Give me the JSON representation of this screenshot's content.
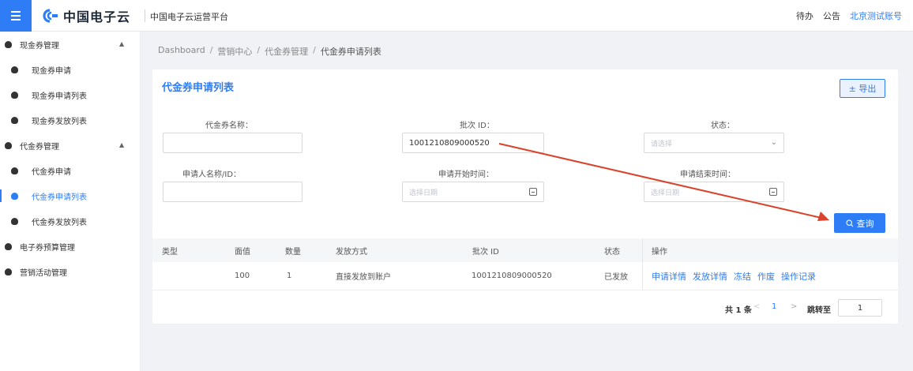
{
  "header": {
    "logo_text": "中国电子云",
    "platform_name": "中国电子云运营平台",
    "todo_label": "待办",
    "notice_label": "公告",
    "account_label": "北京测试账号"
  },
  "sidebar": {
    "groups": [
      {
        "label": "现金券管理",
        "items": [
          "现金券申请",
          "现金券申请列表",
          "现金券发放列表"
        ]
      },
      {
        "label": "代金券管理",
        "items": [
          "代金券申请",
          "代金券申请列表",
          "代金券发放列表"
        ]
      },
      {
        "label": "电子券预算管理"
      },
      {
        "label": "营销活动管理"
      }
    ],
    "active_item": "代金券申请列表"
  },
  "breadcrumb": [
    "Dashboard",
    "营销中心",
    "代金券管理",
    "代金券申请列表"
  ],
  "breadcrumb_separator": "/",
  "card": {
    "title": "代金券申请列表",
    "export_label": "± 导出"
  },
  "filters": {
    "voucher_name_label": "代金券名称：",
    "voucher_name_value": "",
    "batch_id_label": "批次 ID：",
    "batch_id_value": "1001210809000520",
    "status_label": "状态：",
    "status_placeholder": "请选择",
    "applicant_label": "申请人名称/ID：",
    "applicant_value": "",
    "start_time_label": "申请开始时间：",
    "start_time_placeholder": "选择日期",
    "end_time_label": "申请结束时间：",
    "end_time_placeholder": "选择日期",
    "query_label": "查询"
  },
  "table": {
    "columns": [
      "类型",
      "面值",
      "数量",
      "发放方式",
      "批次 ID",
      "状态",
      "操作"
    ],
    "rows": [
      {
        "type": "",
        "value": "100",
        "qty": "1",
        "method": "直接发放到账户",
        "batch_id": "1001210809000520",
        "status": "已发放",
        "actions": [
          "申请详情",
          "发放详情",
          "冻结",
          "作废",
          "操作记录"
        ]
      }
    ]
  },
  "pagination": {
    "total": "共 1 条",
    "prev": "<",
    "page": "1",
    "next": ">",
    "jump_label": "跳转至",
    "jump_value": "1"
  },
  "colors": {
    "accent": "#2f7df6",
    "arrow": "#d9432b",
    "background": "#f0f2f5"
  }
}
